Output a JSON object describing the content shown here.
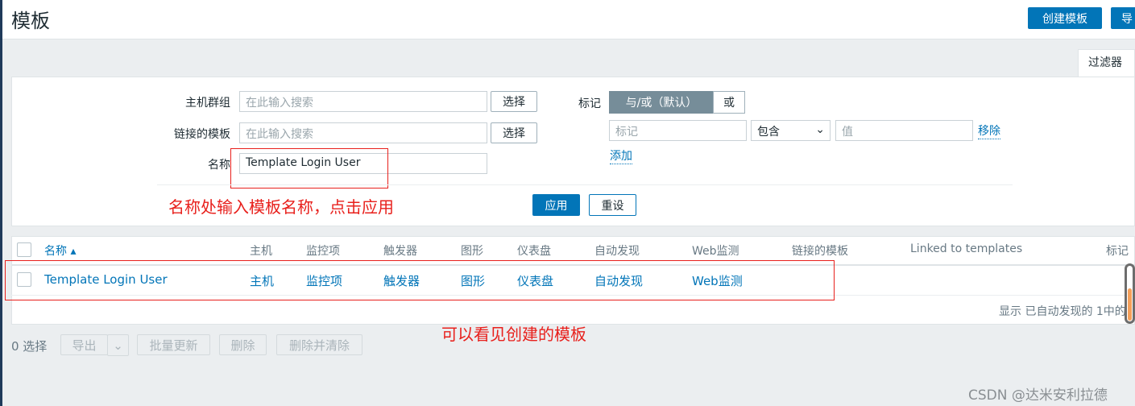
{
  "header": {
    "title": "模板",
    "create_button": "创建模板",
    "import_button": "导"
  },
  "filter": {
    "tab": "过滤器",
    "host_group_label": "主机群组",
    "host_group_placeholder": "在此输入搜索",
    "select_label": "选择",
    "linked_templates_label": "链接的模板",
    "linked_templates_placeholder": "在此输入搜索",
    "name_label": "名称",
    "name_value": "Template Login User",
    "tags_label": "标记",
    "and_or": "与/或（默认）",
    "or": "或",
    "tag_placeholder": "标记",
    "operator": "包含",
    "value_placeholder": "值",
    "remove": "移除",
    "add": "添加",
    "apply": "应用",
    "reset": "重设"
  },
  "annotations": {
    "name_hint": "名称处输入模板名称，点击应用",
    "result_hint": "可以看见创建的模板"
  },
  "table": {
    "columns": [
      "名称 ▴",
      "主机",
      "监控项",
      "触发器",
      "图形",
      "仪表盘",
      "自动发现",
      "Web监测",
      "链接的模板",
      "Linked to templates",
      "标记"
    ],
    "rows": [
      {
        "name": "Template Login User",
        "hosts": "主机",
        "items": "监控项",
        "triggers": "触发器",
        "graphs": "图形",
        "dashboards": "仪表盘",
        "discovery": "自动发现",
        "web": "Web监测"
      }
    ],
    "footer": "显示 已自动发现的 1中的"
  },
  "actions": {
    "selected": "0 选择",
    "export": "导出",
    "mass_update": "批量更新",
    "delete": "删除",
    "delete_clear": "删除并清除"
  },
  "watermark": "CSDN @达米安利拉德"
}
